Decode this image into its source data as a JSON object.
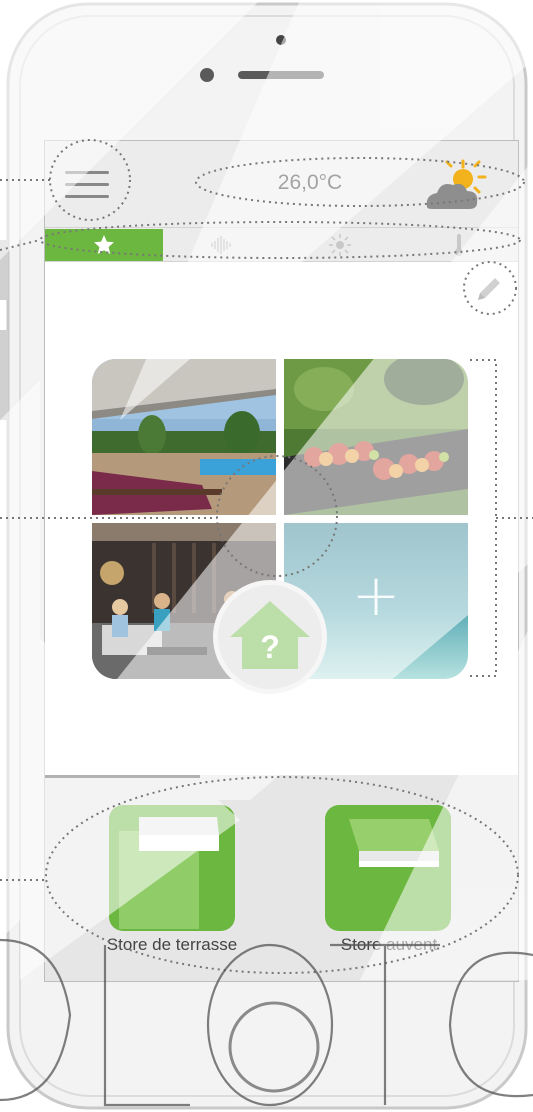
{
  "app": {
    "temperature": "26,0°C",
    "weather_icon": "partly-cloudy-sun-icon",
    "accent_color": "#6cb73f"
  },
  "tabs": [
    {
      "icon": "star-icon",
      "active": true
    },
    {
      "icon": "sound-wave-icon",
      "active": false
    },
    {
      "icon": "sun-icon",
      "active": false
    },
    {
      "icon": "thermometer-icon",
      "active": false
    }
  ],
  "scene": {
    "center_symbol": "?",
    "add_symbol": "+",
    "tiles": [
      "pool-terrace-photo",
      "barbecue-photo",
      "evening-terrace-photo",
      "add-scene-tile"
    ]
  },
  "devices": [
    {
      "label": "Store de terrasse",
      "icon": "terrace-awning-icon"
    },
    {
      "label": "Store auvent",
      "icon": "awning-icon"
    }
  ],
  "watermark": "OLOTO"
}
